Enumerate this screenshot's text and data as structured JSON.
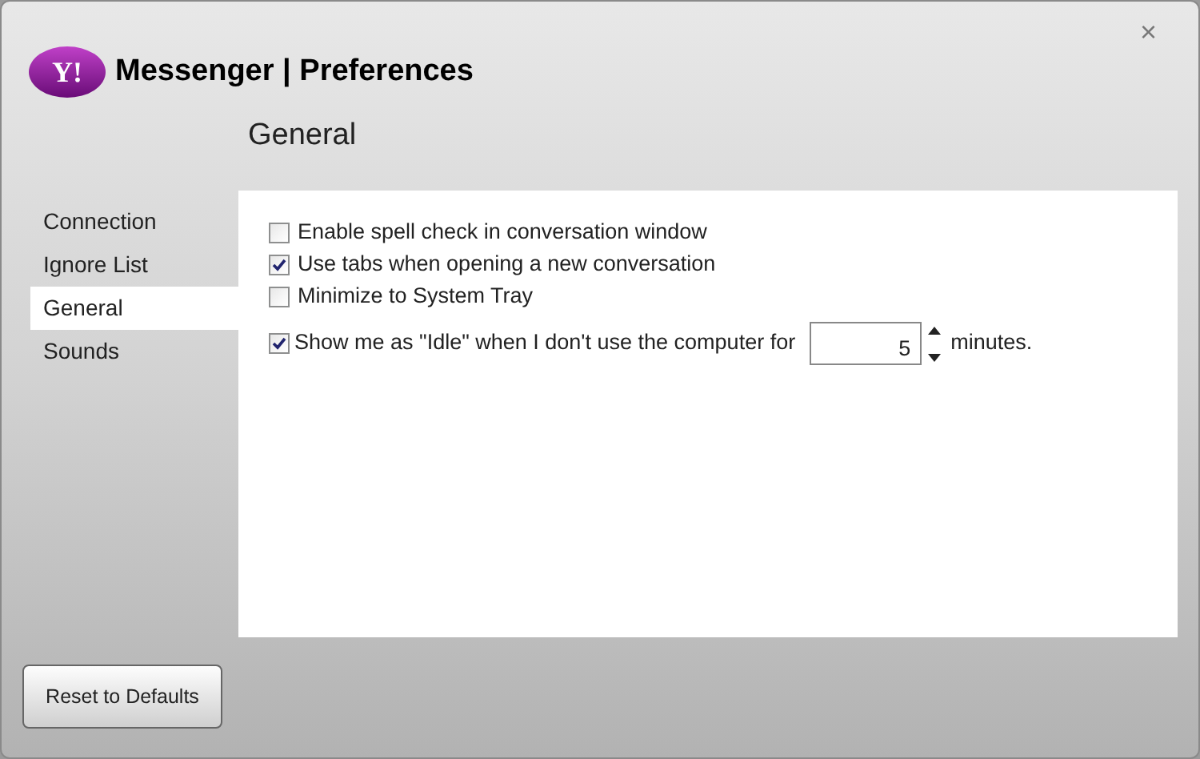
{
  "window": {
    "title": "Messenger | Preferences",
    "logo": "Y!",
    "close": "×"
  },
  "sidebar": {
    "items": [
      {
        "label": "Connection",
        "selected": false
      },
      {
        "label": "Ignore List",
        "selected": false
      },
      {
        "label": "General",
        "selected": true
      },
      {
        "label": "Sounds",
        "selected": false
      }
    ]
  },
  "section_title": "General",
  "options": [
    {
      "kind": "checkbox",
      "label": "Enable spell check in conversation window",
      "checked": false
    },
    {
      "kind": "checkbox",
      "label": "Use tabs when opening a new conversation",
      "checked": true
    },
    {
      "kind": "checkbox",
      "label": "Minimize to System Tray",
      "checked": false
    },
    {
      "kind": "spinner",
      "label": "Show me as \"Idle\" when I don't use the computer for",
      "checked": true,
      "value": "5",
      "suffix": "minutes."
    }
  ],
  "buttons": [
    {
      "label": "Reset to Defaults"
    }
  ]
}
